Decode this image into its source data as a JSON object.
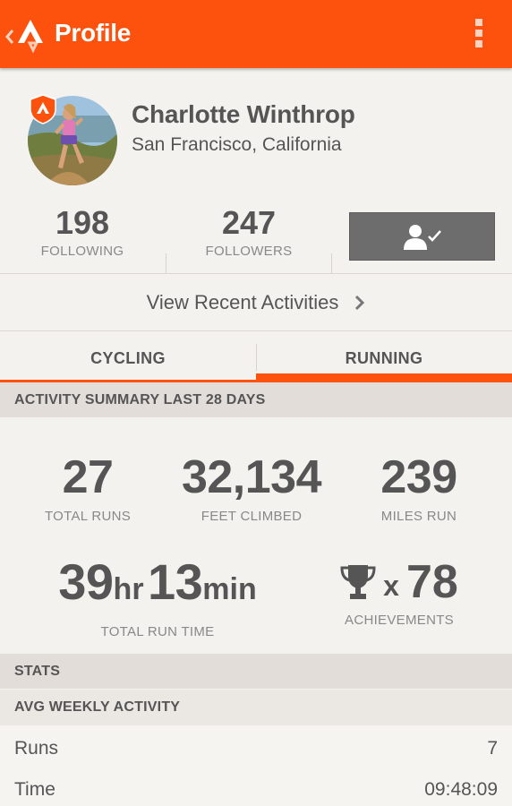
{
  "appbar": {
    "title": "Profile",
    "logo_icon": "strava-logo-icon",
    "menu_icon": "overflow-menu-icon",
    "color": "#fc520d"
  },
  "profile": {
    "name": "Charlotte Winthrop",
    "location": "San Francisco, California",
    "badge_icon": "premium-shield-icon"
  },
  "social": {
    "following_count": "198",
    "following_label": "FOLLOWING",
    "followers_count": "247",
    "followers_label": "FOLLOWERS",
    "follow_button_icon": "following-check-icon"
  },
  "recent_link": "View Recent Activities",
  "tabs": [
    {
      "label": "CYCLING",
      "active": false
    },
    {
      "label": "RUNNING",
      "active": true
    }
  ],
  "summary": {
    "header": "ACTIVITY SUMMARY LAST 28 DAYS",
    "total_runs": "27",
    "total_runs_label": "TOTAL RUNS",
    "feet_climbed": "32,134",
    "feet_climbed_label": "FEET CLIMBED",
    "miles_run": "239",
    "miles_run_label": "MILES RUN",
    "run_hours": "39",
    "run_hours_unit": "hr",
    "run_minutes": "13",
    "run_minutes_unit": "min",
    "run_time_label": "TOTAL RUN TIME",
    "achievements_prefix": "x",
    "achievements": "78",
    "achievements_label": "ACHIEVEMENTS",
    "trophy_icon": "trophy-icon"
  },
  "stats": {
    "header": "STATS",
    "subheader": "AVG WEEKLY ACTIVITY",
    "rows": [
      {
        "label": "Runs",
        "value": "7"
      },
      {
        "label": "Time",
        "value": "09:48:09"
      }
    ]
  }
}
